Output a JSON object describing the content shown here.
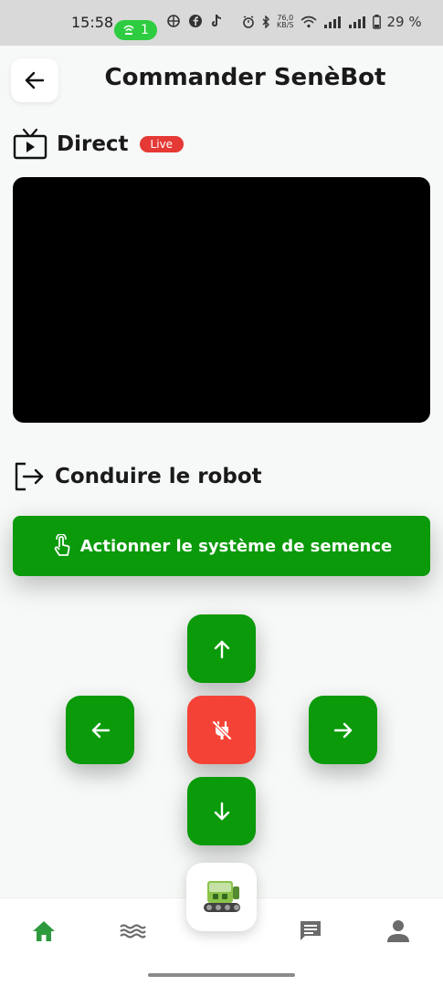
{
  "status_bar": {
    "time": "15:58",
    "pill_count": "1",
    "network_speed_top": "76,0",
    "network_speed_unit": "KB/S",
    "battery": "29 %"
  },
  "header": {
    "title": "Commander SenèBot",
    "back_icon": "arrow-left-icon"
  },
  "live_section": {
    "title": "Direct",
    "badge": "Live",
    "icon": "tv-icon"
  },
  "drive_section": {
    "title": "Conduire le robot",
    "icon": "exit-arrow-icon"
  },
  "seed_button": {
    "label": "Actionner le système de semence",
    "icon": "touch-icon"
  },
  "dpad": {
    "up_icon": "arrow-up-icon",
    "left_icon": "arrow-left-icon",
    "stop_icon": "power-off-icon",
    "right_icon": "arrow-right-icon",
    "down_icon": "arrow-down-icon"
  },
  "bottom_nav": {
    "items": [
      {
        "icon": "home-icon",
        "active": true
      },
      {
        "icon": "waves-icon",
        "active": false
      },
      {
        "icon": "robot-icon",
        "active": false
      },
      {
        "icon": "chat-icon",
        "active": false
      },
      {
        "icon": "person-icon",
        "active": false
      }
    ]
  },
  "colors": {
    "primary_green": "#0a9a0a",
    "stop_red": "#f44336",
    "live_red": "#e53935",
    "nav_active": "#2e9a3e",
    "nav_inactive": "#6b6b6b"
  }
}
